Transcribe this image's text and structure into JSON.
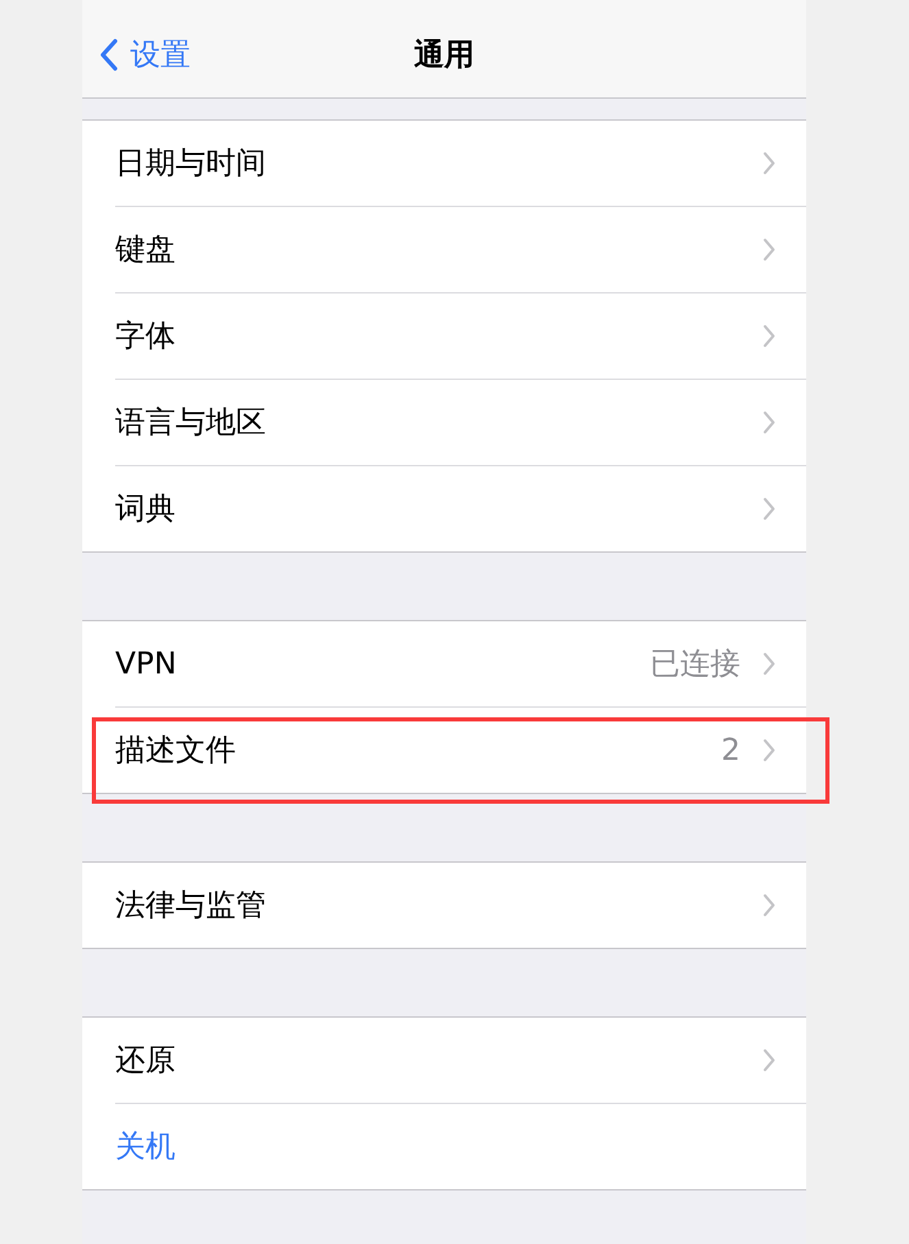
{
  "nav": {
    "back": "设置",
    "title": "通用"
  },
  "groups": [
    {
      "rows": [
        {
          "kind": "link",
          "label": "日期与时间",
          "highlighted": false
        },
        {
          "kind": "link",
          "label": "键盘",
          "highlighted": false
        },
        {
          "kind": "link",
          "label": "字体",
          "highlighted": false
        },
        {
          "kind": "link",
          "label": "语言与地区",
          "highlighted": false
        },
        {
          "kind": "link",
          "label": "词典",
          "highlighted": false
        }
      ]
    },
    {
      "rows": [
        {
          "kind": "link",
          "label": "VPN",
          "value": "已连接",
          "highlighted": false
        },
        {
          "kind": "link",
          "label": "描述文件",
          "value": "2",
          "highlighted": true
        }
      ]
    },
    {
      "rows": [
        {
          "kind": "link",
          "label": "法律与监管",
          "highlighted": false
        }
      ]
    },
    {
      "rows": [
        {
          "kind": "link",
          "label": "还原",
          "highlighted": false
        },
        {
          "kind": "action",
          "label": "关机",
          "highlighted": false
        }
      ]
    }
  ]
}
